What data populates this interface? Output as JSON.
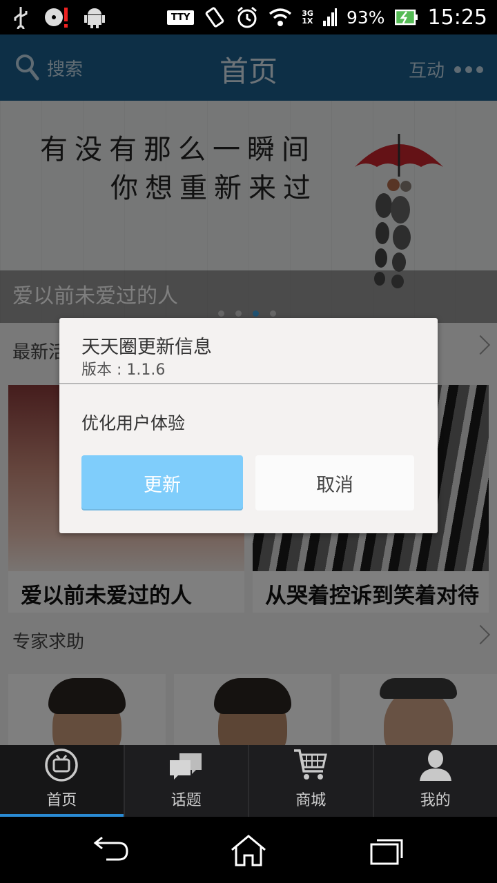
{
  "status_bar": {
    "tty": "TTY",
    "network": "3G\n1X",
    "battery": "93%",
    "time": "15:25"
  },
  "header": {
    "search_label": "搜索",
    "title": "首页",
    "interact_label": "互动"
  },
  "banner": {
    "line1": "有没有那么一瞬间",
    "line2": "你想重新来过",
    "caption": "爱以前未爱过的人",
    "page_count": 4,
    "active_page": 3
  },
  "section_latest": {
    "label": "最新活动"
  },
  "cards": [
    {
      "title": "爱以前未爱过的人"
    },
    {
      "title": "从哭着控诉到笑着对待"
    }
  ],
  "section_experts": {
    "label": "专家求助"
  },
  "dialog": {
    "title": "天天圈更新信息",
    "version": "版本 : 1.1.6",
    "message": "优化用户体验",
    "update_label": "更新",
    "cancel_label": "取消"
  },
  "tabbar": {
    "items": [
      {
        "label": "首页",
        "icon": "home-tv-icon"
      },
      {
        "label": "话题",
        "icon": "chat-bubbles-icon"
      },
      {
        "label": "商城",
        "icon": "shopping-cart-icon"
      },
      {
        "label": "我的",
        "icon": "person-icon"
      }
    ],
    "active_index": 0
  },
  "colors": {
    "header": "#1b5f8c",
    "update_button": "#7fcdfb",
    "tab_indicator": "#2a8bd4"
  }
}
